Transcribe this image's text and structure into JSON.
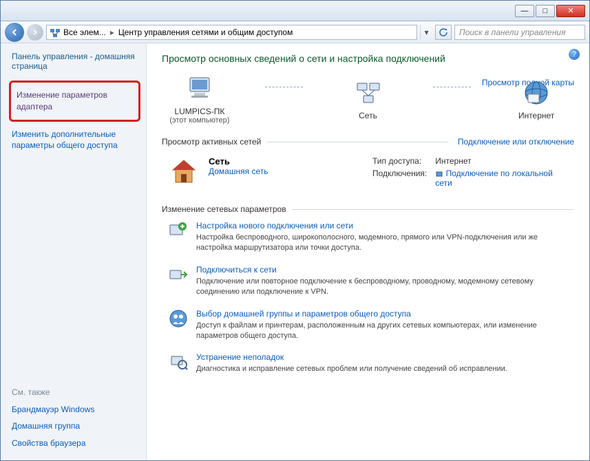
{
  "titlebar": {
    "minimize": "—",
    "maximize": "□",
    "close": "✕"
  },
  "navbar": {
    "breadcrumb1": "Все элем...",
    "breadcrumb2": "Центр управления сетями и общим доступом",
    "search_placeholder": "Поиск в панели управления"
  },
  "sidebar": {
    "home": "Панель управления - домашняя страница",
    "adapter_settings": "Изменение параметров адаптера",
    "advanced_sharing": "Изменить дополнительные параметры общего доступа",
    "see_also_label": "См. также",
    "firewall": "Брандмауэр Windows",
    "homegroup": "Домашняя группа",
    "browser_props": "Свойства браузера"
  },
  "main": {
    "heading": "Просмотр основных сведений о сети и настройка подключений",
    "map_link": "Просмотр полной карты",
    "node_pc": "LUMPICS-ПК",
    "node_pc_sub": "(этот компьютер)",
    "node_net": "Сеть",
    "node_internet": "Интернет",
    "active_hdr": "Просмотр активных сетей",
    "connect_link": "Подключение или отключение",
    "net_name": "Сеть",
    "net_type": "Домашняя сеть",
    "access_label": "Тип доступа:",
    "access_value": "Интернет",
    "conn_label": "Подключения:",
    "conn_value": "Подключение по локальной сети",
    "change_hdr": "Изменение сетевых параметров",
    "tasks": [
      {
        "title": "Настройка нового подключения или сети",
        "desc": "Настройка беспроводного, широкополосного, модемного, прямого или VPN-подключения или же настройка маршрутизатора или точки доступа."
      },
      {
        "title": "Подключиться к сети",
        "desc": "Подключение или повторное подключение к беспроводному, проводному, модемному сетевому соединению или подключение к VPN."
      },
      {
        "title": "Выбор домашней группы и параметров общего доступа",
        "desc": "Доступ к файлам и принтерам, расположенным на других сетевых компьютерах, или изменение параметров общего доступа."
      },
      {
        "title": "Устранение неполадок",
        "desc": "Диагностика и исправление сетевых проблем или получение сведений об исправлении."
      }
    ]
  }
}
